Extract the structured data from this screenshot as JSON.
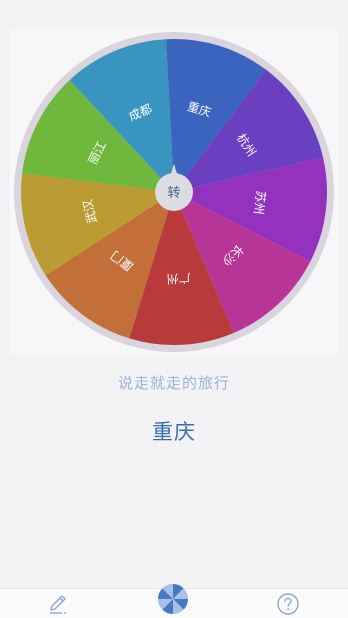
{
  "wheel": {
    "center_label": "转",
    "segments": [
      {
        "label": "重庆",
        "color": "#3a64bd"
      },
      {
        "label": "杭州",
        "color": "#6a3fc0"
      },
      {
        "label": "苏州",
        "color": "#9432bd"
      },
      {
        "label": "长沙",
        "color": "#b73596"
      },
      {
        "label": "广州",
        "color": "#b83a3a"
      },
      {
        "label": "厦门",
        "color": "#c36f39"
      },
      {
        "label": "武汉",
        "color": "#bb9c34"
      },
      {
        "label": "丽江",
        "color": "#6fb83d"
      },
      {
        "label": "成都",
        "color": "#3a94c0"
      }
    ],
    "rim_color": "#d9d4dd",
    "hub_color": "#dcdde2"
  },
  "subtitle": "说走就走的旅行",
  "result": "重庆",
  "tabbar": {
    "edit_icon": "pencil-icon",
    "spin_icon": "pinwheel-icon",
    "help_icon": "question-circle-icon",
    "icon_color": "#8aa7d6"
  }
}
